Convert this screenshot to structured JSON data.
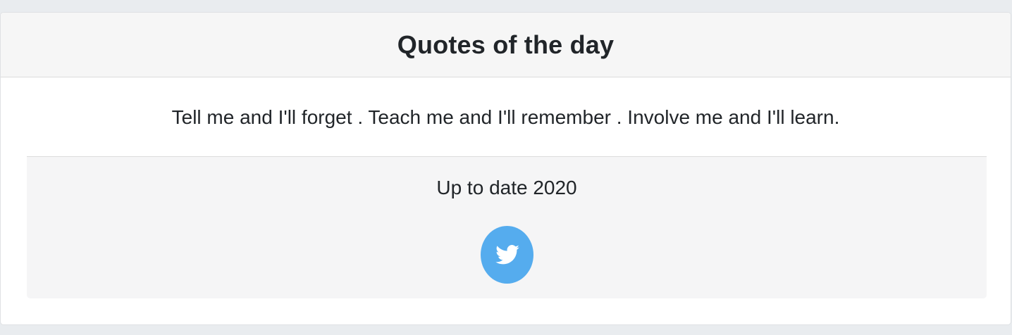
{
  "header": {
    "title": "Quotes of the day"
  },
  "quote": {
    "text": "Tell me and I'll forget . Teach me and I'll remember . Involve me and I'll learn."
  },
  "footer": {
    "text": "Up to date 2020",
    "share_icon": "twitter-icon",
    "share_color": "#55acee"
  },
  "colors": {
    "page_background": "#e9ecef",
    "card_background": "#ffffff",
    "header_background": "#f6f6f6",
    "footer_background": "#f5f5f6",
    "text": "#212529"
  }
}
